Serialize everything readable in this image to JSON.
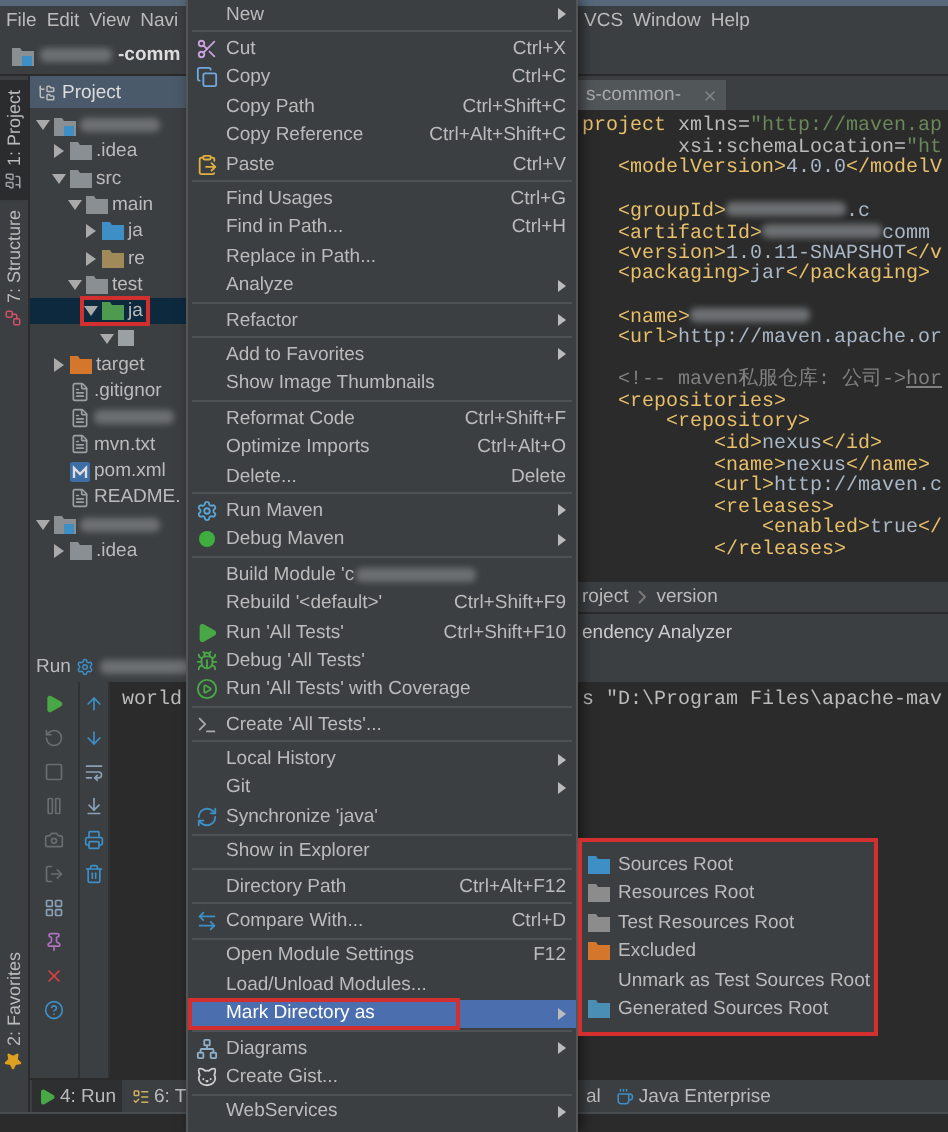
{
  "menu_bar": {
    "left": [
      "File",
      "Edit",
      "View",
      "Navi"
    ],
    "right": [
      "VCS",
      "Window",
      "Help"
    ]
  },
  "nav_bar": {
    "project_suffix": "-comm"
  },
  "side_tabs_top": [
    {
      "label": "1: Project",
      "selected": true
    },
    {
      "label": "7: Structure",
      "selected": false
    }
  ],
  "side_tabs_bottom": [
    {
      "label": "2: Favorites",
      "selected": false
    }
  ],
  "project_panel": {
    "title": "Project",
    "tree": [
      {
        "kind": "module",
        "expanded": true,
        "selected": false,
        "highlighted": false,
        "children": [
          {
            "kind": "folder",
            "name": ".idea",
            "expanded": false,
            "color": "#8a8f93",
            "selected": false,
            "highlighted": false
          },
          {
            "kind": "folder",
            "name": "src",
            "expanded": true,
            "color": "#8a8f93",
            "selected": false,
            "highlighted": false,
            "children": [
              {
                "kind": "folder",
                "name": "main",
                "expanded": true,
                "color": "#8a8f93",
                "selected": false,
                "highlighted": false,
                "children": [
                  {
                    "kind": "folder",
                    "name": "ja",
                    "expanded": false,
                    "color": "#3d8fc6",
                    "selected": false,
                    "highlighted": false
                  },
                  {
                    "kind": "folder",
                    "name": "re",
                    "expanded": false,
                    "color": "#a08a5a",
                    "selected": false,
                    "highlighted": false
                  }
                ]
              },
              {
                "kind": "folder",
                "name": "test",
                "expanded": true,
                "color": "#8a8f93",
                "selected": false,
                "highlighted": false,
                "children": [
                  {
                    "kind": "folder",
                    "name": "ja",
                    "expanded": true,
                    "color": "#4e9a4e",
                    "selected": true,
                    "highlighted": true,
                    "children": [
                      {
                        "kind": "package",
                        "expanded": true,
                        "selected": false,
                        "highlighted": false
                      }
                    ]
                  }
                ]
              }
            ]
          },
          {
            "kind": "folder",
            "name": "target",
            "expanded": false,
            "color": "#d4762c",
            "selected": false,
            "highlighted": false
          },
          {
            "kind": "file",
            "name": ".gitignor",
            "selected": false,
            "highlighted": false
          },
          {
            "kind": "file",
            "selected": false,
            "highlighted": false
          },
          {
            "kind": "file",
            "name": "mvn.txt",
            "selected": false,
            "highlighted": false
          },
          {
            "kind": "maven",
            "name": "pom.xml",
            "selected": false,
            "highlighted": false
          },
          {
            "kind": "file",
            "name": "README.",
            "selected": false,
            "highlighted": false
          }
        ]
      },
      {
        "kind": "module",
        "expanded": true,
        "selected": false,
        "highlighted": false,
        "children": [
          {
            "kind": "folder",
            "name": ".idea",
            "expanded": false,
            "color": "#8a8f93",
            "selected": false,
            "highlighted": false
          }
        ]
      }
    ]
  },
  "editor": {
    "tab": "s-common-",
    "blocks": [
      [
        [
          {
            "kind": "tag",
            "text": "project"
          },
          {
            "kind": "attr",
            "text": " xmlns="
          },
          {
            "kind": "value",
            "text": "\"http://maven.ap"
          }
        ],
        [
          {
            "kind": "attr",
            "text": "        xsi:schemaLocation="
          },
          {
            "kind": "value",
            "text": "\"ht"
          }
        ],
        [
          {
            "kind": "tag",
            "text": "   <modelVersion>"
          },
          {
            "kind": "text",
            "text": "4.0.0"
          },
          {
            "kind": "tag",
            "text": "</modelV"
          }
        ]
      ],
      [
        [
          {
            "kind": "tag",
            "text": "   <groupId>"
          },
          {
            "kind": "blur"
          },
          {
            "kind": "text",
            "text": ".c"
          }
        ],
        [
          {
            "kind": "tag",
            "text": "   <artifactId>"
          },
          {
            "kind": "blur"
          },
          {
            "kind": "text",
            "text": "comm"
          }
        ],
        [
          {
            "kind": "tag",
            "text": "   <version>"
          },
          {
            "kind": "text",
            "text": "1.0.11-SNAPSHOT"
          },
          {
            "kind": "tag",
            "text": "</v"
          }
        ],
        [
          {
            "kind": "tag",
            "text": "   <packaging>"
          },
          {
            "kind": "text",
            "text": "jar"
          },
          {
            "kind": "tag",
            "text": "</packaging>"
          }
        ]
      ],
      [
        [
          {
            "kind": "tag",
            "text": "   <name>"
          },
          {
            "kind": "blur"
          }
        ],
        [
          {
            "kind": "tag",
            "text": "   <url>"
          },
          {
            "kind": "text",
            "text": "http://maven.apache.or"
          }
        ]
      ],
      [
        [
          {
            "kind": "comment",
            "text": "   <!-- maven私服仓库: 公司->"
          },
          {
            "kind": "link",
            "text": "hor"
          }
        ],
        [
          {
            "kind": "tag",
            "text": "   <repositories>"
          }
        ],
        [
          {
            "kind": "tag",
            "text": "       <repository>"
          }
        ],
        [
          {
            "kind": "tag",
            "text": "           <id>"
          },
          {
            "kind": "text",
            "text": "nexus"
          },
          {
            "kind": "tag",
            "text": "</id>"
          }
        ],
        [
          {
            "kind": "tag",
            "text": "           <name>"
          },
          {
            "kind": "text",
            "text": "nexus"
          },
          {
            "kind": "tag",
            "text": "</name>"
          }
        ],
        [
          {
            "kind": "tag",
            "text": "           <url>"
          },
          {
            "kind": "text",
            "text": "http://maven.c"
          }
        ],
        [
          {
            "kind": "tag",
            "text": "           <releases>"
          }
        ],
        [
          {
            "kind": "tag",
            "text": "               <enabled>"
          },
          {
            "kind": "text",
            "text": "true"
          },
          {
            "kind": "tag",
            "text": "</"
          }
        ],
        [
          {
            "kind": "tag",
            "text": "           </releases>"
          }
        ]
      ]
    ],
    "breadcrumbs": [
      "roject",
      "version"
    ],
    "tool_header": "endency Analyzer"
  },
  "run_panel": {
    "title": "Run",
    "console_left": "world",
    "console_right": "s \"D:\\Program Files\\apache-mav"
  },
  "bottom_bar": {
    "tabs": [
      {
        "label": "4: Run",
        "selected": true
      },
      {
        "label": "6: T",
        "selected": false
      }
    ],
    "right": [
      {
        "label": "al"
      },
      {
        "label": "Java Enterprise"
      }
    ]
  },
  "context_menu": {
    "items": [
      {
        "kind": "item",
        "label": "New",
        "submenu": true,
        "selected": false,
        "highlighted": false
      },
      {
        "kind": "separator"
      },
      {
        "kind": "item",
        "label": "Cut",
        "shortcut": "Ctrl+X",
        "submenu": false,
        "selected": false,
        "highlighted": false
      },
      {
        "kind": "item",
        "label": "Copy",
        "shortcut": "Ctrl+C",
        "submenu": false,
        "selected": false,
        "highlighted": false
      },
      {
        "kind": "item",
        "label": "Copy Path",
        "shortcut": "Ctrl+Shift+C",
        "submenu": false,
        "selected": false,
        "highlighted": false
      },
      {
        "kind": "item",
        "label": "Copy Reference",
        "shortcut": "Ctrl+Alt+Shift+C",
        "submenu": false,
        "selected": false,
        "highlighted": false
      },
      {
        "kind": "item",
        "label": "Paste",
        "shortcut": "Ctrl+V",
        "submenu": false,
        "selected": false,
        "highlighted": false
      },
      {
        "kind": "separator"
      },
      {
        "kind": "item",
        "label": "Find Usages",
        "shortcut": "Ctrl+G",
        "submenu": false,
        "selected": false,
        "highlighted": false
      },
      {
        "kind": "item",
        "label": "Find in Path...",
        "shortcut": "Ctrl+H",
        "submenu": false,
        "selected": false,
        "highlighted": false
      },
      {
        "kind": "item",
        "label": "Replace in Path...",
        "submenu": false,
        "selected": false,
        "highlighted": false
      },
      {
        "kind": "item",
        "label": "Analyze",
        "submenu": true,
        "selected": false,
        "highlighted": false
      },
      {
        "kind": "separator"
      },
      {
        "kind": "item",
        "label": "Refactor",
        "submenu": true,
        "selected": false,
        "highlighted": false
      },
      {
        "kind": "separator"
      },
      {
        "kind": "item",
        "label": "Add to Favorites",
        "submenu": true,
        "selected": false,
        "highlighted": false
      },
      {
        "kind": "item",
        "label": "Show Image Thumbnails",
        "submenu": false,
        "selected": false,
        "highlighted": false
      },
      {
        "kind": "separator"
      },
      {
        "kind": "item",
        "label": "Reformat Code",
        "shortcut": "Ctrl+Shift+F",
        "submenu": false,
        "selected": false,
        "highlighted": false
      },
      {
        "kind": "item",
        "label": "Optimize Imports",
        "shortcut": "Ctrl+Alt+O",
        "submenu": false,
        "selected": false,
        "highlighted": false
      },
      {
        "kind": "item",
        "label": "Delete...",
        "shortcut": "Delete",
        "submenu": false,
        "selected": false,
        "highlighted": false
      },
      {
        "kind": "separator"
      },
      {
        "kind": "item",
        "label": "Run Maven",
        "submenu": true,
        "selected": false,
        "highlighted": false
      },
      {
        "kind": "item",
        "label": "Debug Maven",
        "submenu": true,
        "selected": false,
        "highlighted": false
      },
      {
        "kind": "separator"
      },
      {
        "kind": "item",
        "label": "Build Module 'c",
        "blurred": true,
        "submenu": false,
        "selected": false,
        "highlighted": false
      },
      {
        "kind": "item",
        "label": "Rebuild '<default>'",
        "shortcut": "Ctrl+Shift+F9",
        "submenu": false,
        "selected": false,
        "highlighted": false
      },
      {
        "kind": "item",
        "label": "Run 'All Tests'",
        "shortcut": "Ctrl+Shift+F10",
        "submenu": false,
        "selected": false,
        "highlighted": false
      },
      {
        "kind": "item",
        "label": "Debug 'All Tests'",
        "submenu": false,
        "selected": false,
        "highlighted": false
      },
      {
        "kind": "item",
        "label": "Run 'All Tests' with Coverage",
        "submenu": false,
        "selected": false,
        "highlighted": false
      },
      {
        "kind": "separator"
      },
      {
        "kind": "item",
        "label": "Create 'All Tests'...",
        "submenu": false,
        "selected": false,
        "highlighted": false
      },
      {
        "kind": "separator"
      },
      {
        "kind": "item",
        "label": "Local History",
        "submenu": true,
        "selected": false,
        "highlighted": false
      },
      {
        "kind": "item",
        "label": "Git",
        "submenu": true,
        "selected": false,
        "highlighted": false
      },
      {
        "kind": "item",
        "label": "Synchronize 'java'",
        "submenu": false,
        "selected": false,
        "highlighted": false
      },
      {
        "kind": "separator"
      },
      {
        "kind": "item",
        "label": "Show in Explorer",
        "submenu": false,
        "selected": false,
        "highlighted": false
      },
      {
        "kind": "separator"
      },
      {
        "kind": "item",
        "label": "Directory Path",
        "shortcut": "Ctrl+Alt+F12",
        "submenu": false,
        "selected": false,
        "highlighted": false
      },
      {
        "kind": "separator"
      },
      {
        "kind": "item",
        "label": "Compare With...",
        "shortcut": "Ctrl+D",
        "submenu": false,
        "selected": false,
        "highlighted": false
      },
      {
        "kind": "separator"
      },
      {
        "kind": "item",
        "label": "Open Module Settings",
        "shortcut": "F12",
        "submenu": false,
        "selected": false,
        "highlighted": false
      },
      {
        "kind": "item",
        "label": "Load/Unload Modules...",
        "submenu": false,
        "selected": false,
        "highlighted": false
      },
      {
        "kind": "item",
        "label": "Mark Directory as",
        "submenu": true,
        "selected": true,
        "highlighted": true
      },
      {
        "kind": "separator"
      },
      {
        "kind": "item",
        "label": "Diagrams",
        "submenu": true,
        "selected": false,
        "highlighted": false
      },
      {
        "kind": "item",
        "label": "Create Gist...",
        "submenu": false,
        "selected": false,
        "highlighted": false
      },
      {
        "kind": "separator"
      },
      {
        "kind": "item",
        "label": "WebServices",
        "submenu": true,
        "selected": false,
        "highlighted": false
      }
    ]
  },
  "submenu": {
    "highlighted": true,
    "items": [
      {
        "label": "Sources Root",
        "color": "#3d8fc6"
      },
      {
        "label": "Resources Root",
        "color": "#8c8c8c"
      },
      {
        "label": "Test Resources Root",
        "color": "#8c8c8c"
      },
      {
        "label": "Excluded",
        "color": "#d4762c"
      },
      {
        "label": "Unmark as Test Sources Root"
      },
      {
        "label": "Generated Sources Root",
        "color": "#4a8db5"
      }
    ]
  }
}
